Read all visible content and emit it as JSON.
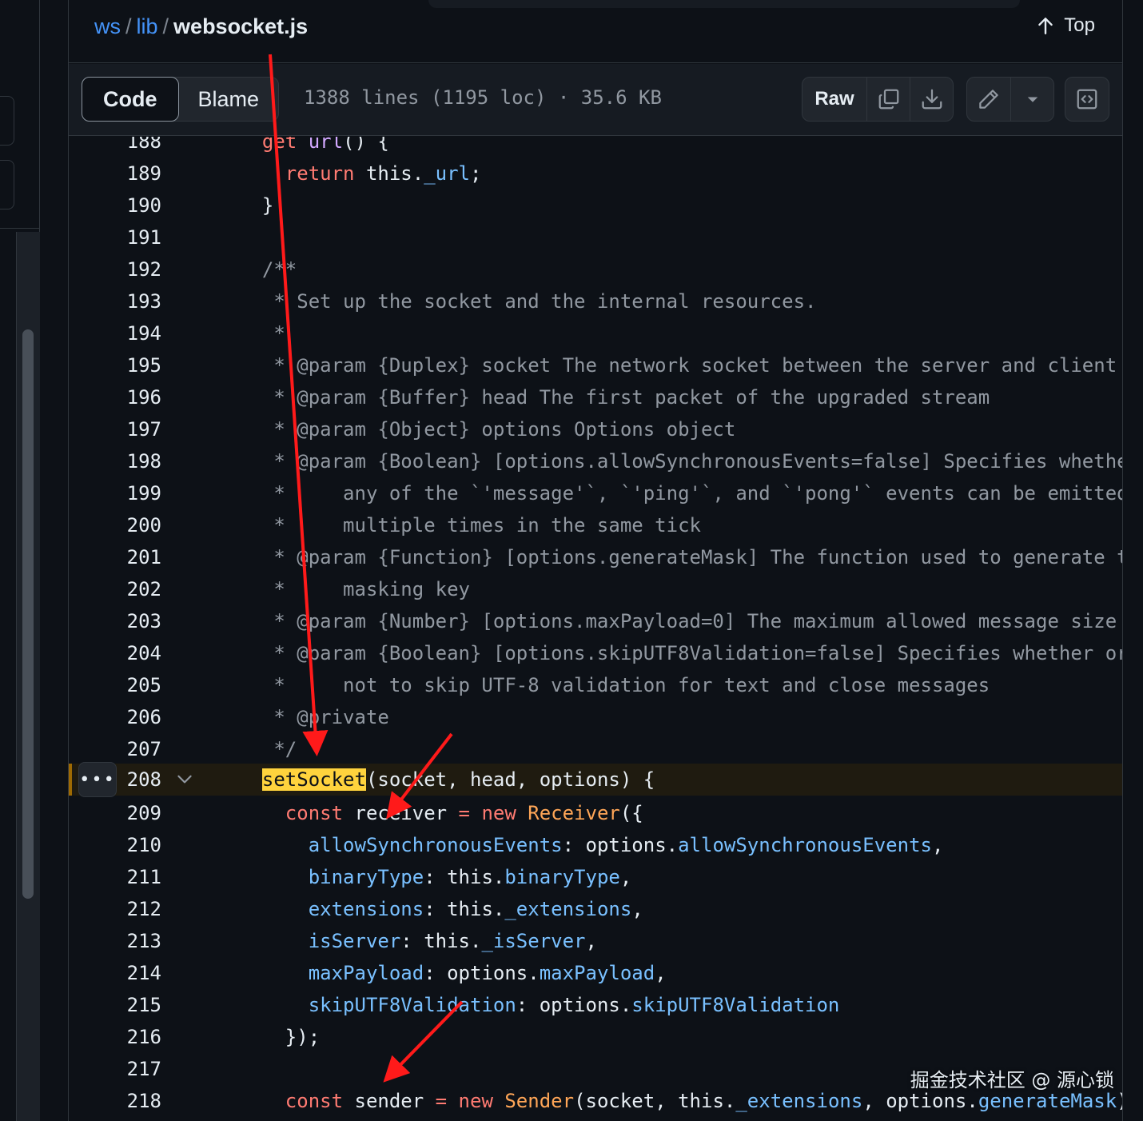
{
  "breadcrumb": {
    "repo": "ws",
    "dir": "lib",
    "sep": "/",
    "file": "websocket.js"
  },
  "header": {
    "top_label": "Top"
  },
  "toolbar": {
    "code_label": "Code",
    "blame_label": "Blame",
    "meta": "1388 lines (1195 loc) · 35.6 KB",
    "raw_label": "Raw",
    "icons": [
      "copy-icon",
      "download-icon",
      "pencil-icon",
      "triangle-down-icon",
      "symbols-panel-icon"
    ]
  },
  "code": {
    "highlighted_line": "208",
    "lines": [
      {
        "n": "188",
        "src": "  get url() {"
      },
      {
        "n": "189",
        "src": "    return this._url;"
      },
      {
        "n": "190",
        "src": "  }"
      },
      {
        "n": "191",
        "src": ""
      },
      {
        "n": "192",
        "src": "  /**"
      },
      {
        "n": "193",
        "src": "   * Set up the socket and the internal resources."
      },
      {
        "n": "194",
        "src": "   *"
      },
      {
        "n": "195",
        "src": "   * @param {Duplex} socket The network socket between the server and client"
      },
      {
        "n": "196",
        "src": "   * @param {Buffer} head The first packet of the upgraded stream"
      },
      {
        "n": "197",
        "src": "   * @param {Object} options Options object"
      },
      {
        "n": "198",
        "src": "   * @param {Boolean} [options.allowSynchronousEvents=false] Specifies whether"
      },
      {
        "n": "199",
        "src": "   *     any of the `'message'`, `'ping'`, and `'pong'` events can be emitted"
      },
      {
        "n": "200",
        "src": "   *     multiple times in the same tick"
      },
      {
        "n": "201",
        "src": "   * @param {Function} [options.generateMask] The function used to generate the"
      },
      {
        "n": "202",
        "src": "   *     masking key"
      },
      {
        "n": "203",
        "src": "   * @param {Number} [options.maxPayload=0] The maximum allowed message size"
      },
      {
        "n": "204",
        "src": "   * @param {Boolean} [options.skipUTF8Validation=false] Specifies whether or"
      },
      {
        "n": "205",
        "src": "   *     not to skip UTF-8 validation for text and close messages"
      },
      {
        "n": "206",
        "src": "   * @private"
      },
      {
        "n": "207",
        "src": "   */"
      },
      {
        "n": "208",
        "src": "  setSocket(socket, head, options) {"
      },
      {
        "n": "209",
        "src": "    const receiver = new Receiver({"
      },
      {
        "n": "210",
        "src": "      allowSynchronousEvents: options.allowSynchronousEvents,"
      },
      {
        "n": "211",
        "src": "      binaryType: this.binaryType,"
      },
      {
        "n": "212",
        "src": "      extensions: this._extensions,"
      },
      {
        "n": "213",
        "src": "      isServer: this._isServer,"
      },
      {
        "n": "214",
        "src": "      maxPayload: options.maxPayload,"
      },
      {
        "n": "215",
        "src": "      skipUTF8Validation: options.skipUTF8Validation"
      },
      {
        "n": "216",
        "src": "    });"
      },
      {
        "n": "217",
        "src": ""
      },
      {
        "n": "218",
        "src": "    const sender = new Sender(socket, this._extensions, options.generateMask);"
      }
    ]
  },
  "watermark": "掘金技术社区 @ 源心锁",
  "colors": {
    "background": "#0d1117",
    "keyword": "#ff7b72",
    "comment": "#9198a1",
    "function": "#d2a8ff",
    "property": "#79c0ff",
    "class": "#ffa657",
    "link": "#4493f8",
    "search_match": "#ffd33d",
    "annotation_arrow": "#ff1a1a"
  }
}
